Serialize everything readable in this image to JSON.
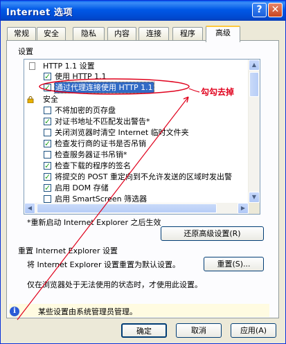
{
  "window": {
    "title": "Internet 选项",
    "help_glyph": "?",
    "close_glyph": "✕"
  },
  "tabs": [
    "常规",
    "安全",
    "隐私",
    "内容",
    "连接",
    "程序",
    "高级"
  ],
  "settings_label": "设置",
  "settings_list": [
    {
      "text": "HTTP 1.1 设置",
      "type": "group",
      "icon": "page-icon"
    },
    {
      "text": "使用 HTTP 1.1",
      "type": "checkbox",
      "checked": true
    },
    {
      "text": "通过代理连接使用 HTTP 1.1",
      "type": "checkbox",
      "checked": true,
      "selected": true
    },
    {
      "text": "安全",
      "type": "group",
      "icon": "lock-icon"
    },
    {
      "text": "不将加密的页存盘",
      "type": "checkbox",
      "checked": false
    },
    {
      "text": "对证书地址不匹配发出警告*",
      "type": "checkbox",
      "checked": true
    },
    {
      "text": "关闭浏览器时清空 Internet 临时文件夹",
      "type": "checkbox",
      "checked": false
    },
    {
      "text": "检查发行商的证书是否吊销",
      "type": "checkbox",
      "checked": true
    },
    {
      "text": "检查服务器证书吊销*",
      "type": "checkbox",
      "checked": false
    },
    {
      "text": "检查下载的程序的签名",
      "type": "checkbox",
      "checked": true
    },
    {
      "text": "将提交的 POST 重定向到不允许发送的区域时发出警",
      "type": "checkbox",
      "checked": true
    },
    {
      "text": "启用 DOM 存储",
      "type": "checkbox",
      "checked": true
    },
    {
      "text": "启用 SmartScreen 筛选器",
      "type": "checkbox",
      "checked": false
    }
  ],
  "restart_note": "*重新启动 Internet Explorer 之后生效",
  "restore_button": "还原高级设置(R)",
  "reset_section_title": "重置 Internet Explorer 设置",
  "reset_desc": "将 Internet Explorer 设置重置为默认设置。",
  "reset_button": "重置(S)...",
  "reset_note": "仅在浏览器处于无法使用的状态时，才使用此设置。",
  "admin_note": "某些设置由系统管理员管理。",
  "buttons": {
    "ok": "确定",
    "cancel": "取消",
    "apply": "应用(A)"
  },
  "annotation": "勾勾去掉",
  "colors": {
    "titlebar": "#0058e6",
    "annotation_red": "#e0001c",
    "selection": "#316ac5",
    "dialog_bg": "#ece9d8"
  }
}
